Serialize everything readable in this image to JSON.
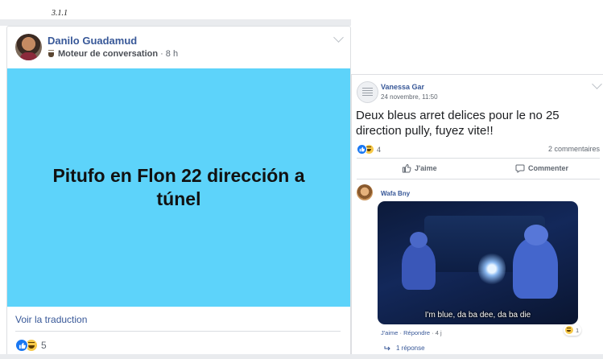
{
  "section_label": "3.1.1",
  "post_left": {
    "author": "Danilo Guadamud",
    "activity": "Moteur de conversation",
    "timestamp": " · 8 h",
    "banner_text": "Pitufo en Flon 22 dirección a túnel",
    "banner_color": "#5dd3fa",
    "see_translation": "Voir la traduction",
    "reaction_count": "5",
    "reaction_icons": [
      "like-icon",
      "haha-icon"
    ]
  },
  "post_right": {
    "author": "Vanessa Gar",
    "timestamp": "24 novembre, 11:50",
    "status": "Deux bleus arret delices pour le no 25 direction pully, fuyez vite!!",
    "reaction_count": "4",
    "comments_count": "2 commentaires",
    "like_label": "J'aime",
    "comment_label": "Commenter",
    "comment": {
      "author": "Wafa Bny",
      "gif_caption": "I'm blue, da ba dee, da ba die",
      "like_link": "J'aime",
      "reply_link": "Répondre",
      "age": "4 j",
      "reaction_count": "1",
      "replies_label": "1 réponse"
    }
  },
  "colors": {
    "link": "#385898",
    "like_blue": "#1877f2",
    "haha_yellow": "#f7c948"
  }
}
